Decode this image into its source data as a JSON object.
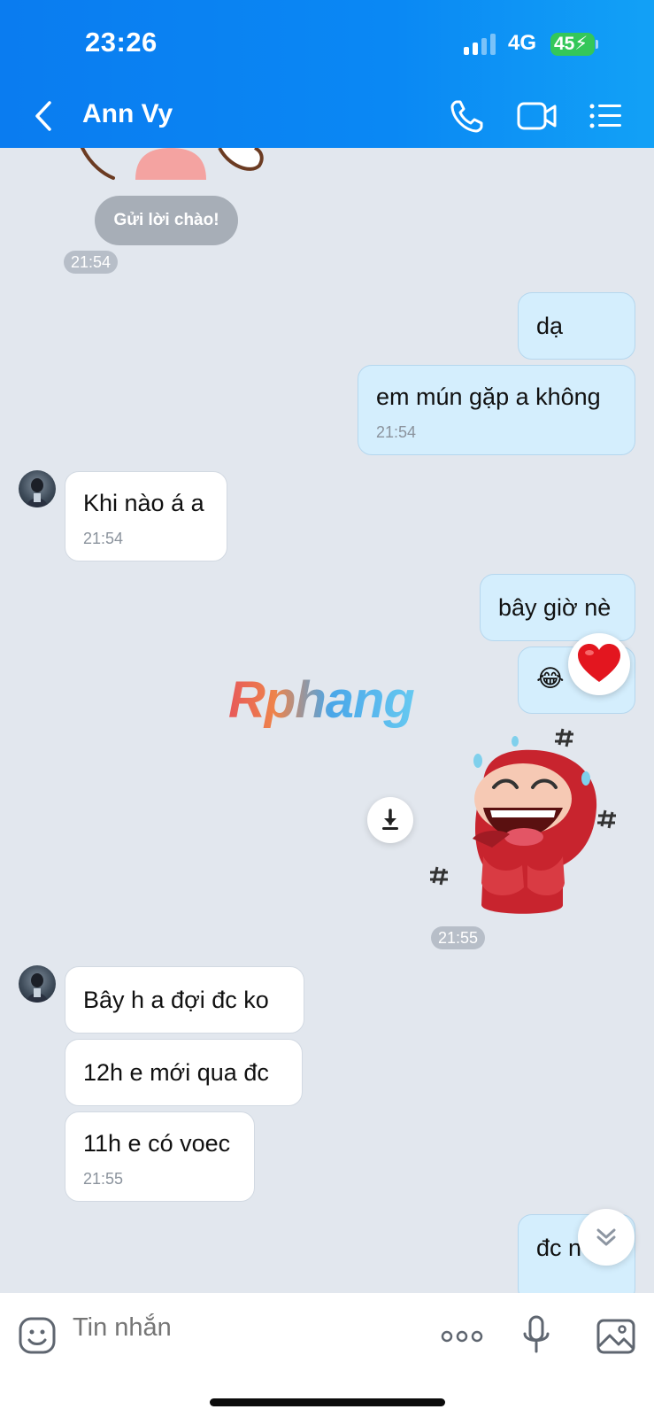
{
  "status_bar": {
    "time": "23:26",
    "network": "4G",
    "battery": "45"
  },
  "header": {
    "contact_name": "Ann Vy"
  },
  "greeting_button": "Gửi lời chào!",
  "greeting_time": "21:54",
  "messages": {
    "m1": {
      "text": "dạ"
    },
    "m2": {
      "text": "em mún gặp a không",
      "time": "21:54"
    },
    "m3": {
      "text": "Khi nào á a",
      "time": "21:54"
    },
    "m4": {
      "text": "bây giờ nè"
    },
    "m5": {
      "text": "😂",
      "reaction": "❤️"
    },
    "sticker_time": "21:55",
    "m6": {
      "text": "Bây h a đợi đc ko"
    },
    "m7": {
      "text": "12h e mới qua đc"
    },
    "m8": {
      "text": "11h e có voec",
      "time": "21:55"
    },
    "m9": {
      "text": "đc nè"
    }
  },
  "watermark": "Rphang",
  "composer": {
    "placeholder": "Tin nhắn"
  },
  "colors": {
    "header": "#0a88f4",
    "outgoing_bubble": "#d4eefd",
    "incoming_bubble": "#ffffff",
    "chat_background": "#e2e7ee"
  },
  "icons": [
    "back-icon",
    "phone-icon",
    "video-call-icon",
    "menu-icon",
    "download-icon",
    "scroll-down-icon",
    "emoji-icon",
    "more-icon",
    "microphone-icon",
    "image-icon"
  ]
}
